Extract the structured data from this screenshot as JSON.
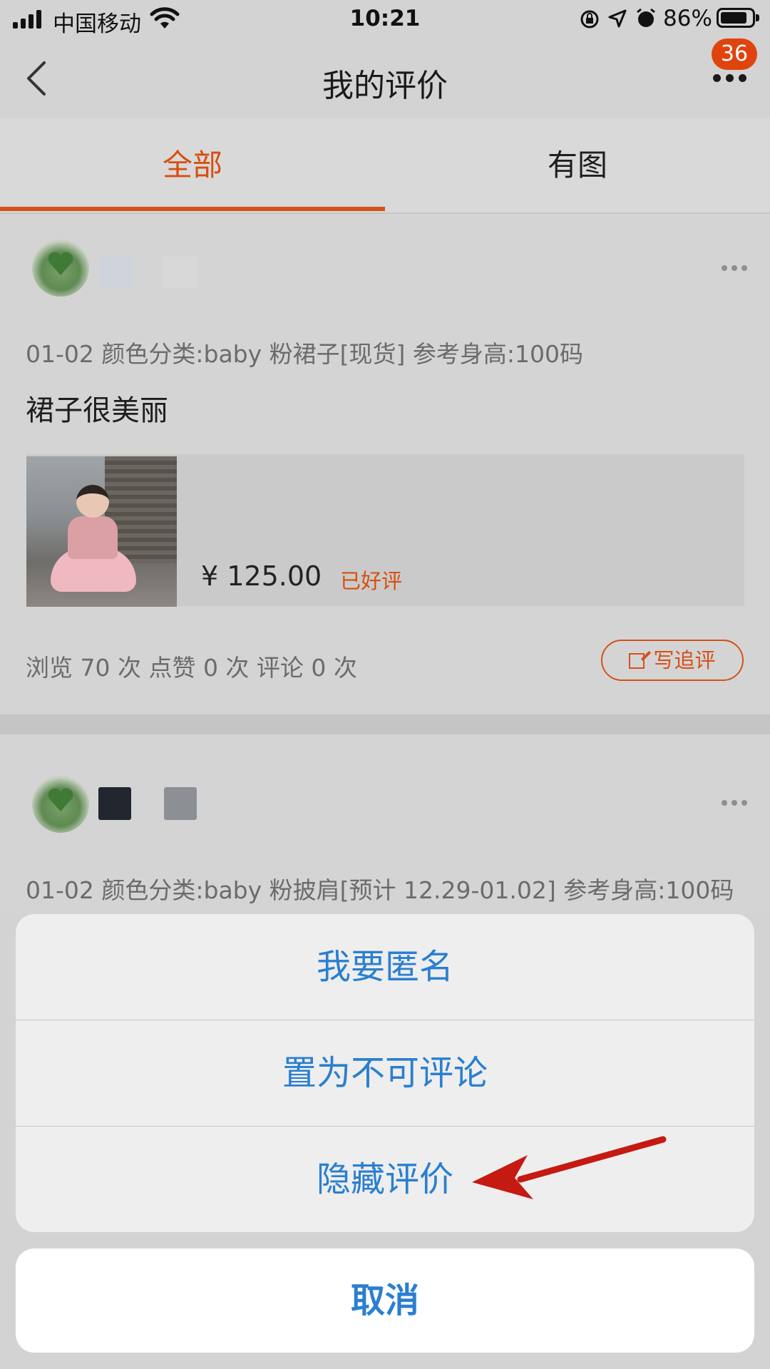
{
  "status_bar": {
    "carrier": "中国移动",
    "time": "10:21",
    "battery_percent": "86%",
    "battery_level": 0.86
  },
  "nav": {
    "title": "我的评价",
    "badge_count": "36",
    "back_icon": "chevron-left-icon",
    "more_icon": "more-dots-icon"
  },
  "tabs": [
    {
      "label": "全部",
      "active": true
    },
    {
      "label": "有图",
      "active": false
    }
  ],
  "reviews": [
    {
      "meta": "01-02 颜色分类:baby 粉裙子[现货] 参考身高:100码",
      "text": "裙子很美丽",
      "price": "¥ 125.00",
      "rating_status": "已好评",
      "stats": "浏览 70 次   点赞 0 次   评论 0 次",
      "follow_label": "写追评"
    },
    {
      "meta": "01-02 颜色分类:baby 粉披肩[预计 12.29-01.02] 参考身高:100码"
    }
  ],
  "action_sheet": {
    "items": [
      "我要匿名",
      "置为不可评论",
      "隐藏评价"
    ],
    "cancel_label": "取消"
  },
  "colors": {
    "accent": "#d5511a",
    "action_blue": "#2a7fd0",
    "arrow_red": "#c41a12"
  }
}
